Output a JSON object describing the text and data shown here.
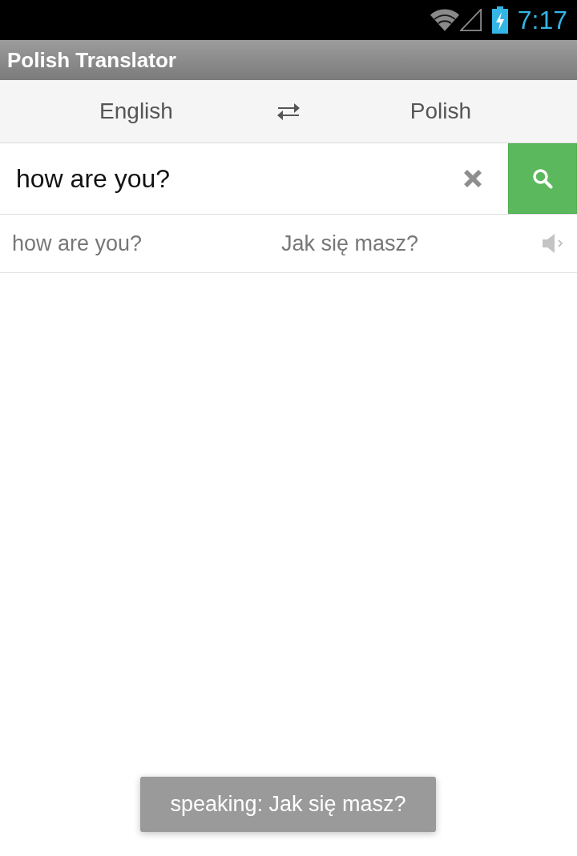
{
  "status_bar": {
    "time": "7:17"
  },
  "app_bar": {
    "title": "Polish Translator"
  },
  "languages": {
    "source": "English",
    "target": "Polish"
  },
  "search": {
    "value": "how are you?"
  },
  "results": [
    {
      "source": "how are you?",
      "translation": "Jak się masz?"
    }
  ],
  "toast": {
    "text": "speaking: Jak się masz?"
  }
}
